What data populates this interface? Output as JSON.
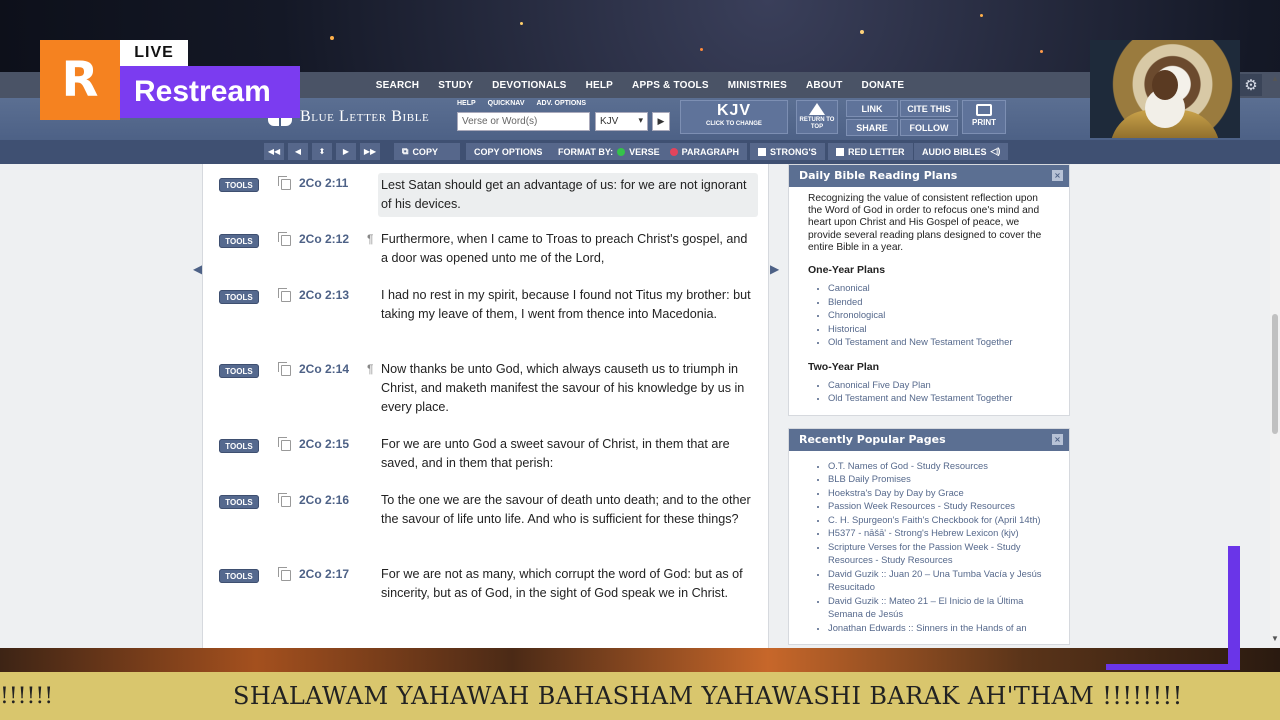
{
  "overlay": {
    "logo_letter": "R",
    "live_label": "LIVE",
    "brand": "Restream",
    "ticker_left": "!!!!!!",
    "ticker_text": "SHALAWAM YAHAWAH BAHASHAM YAHAWASHI BARAK AH'THAM !!!!!!!!"
  },
  "colors": {
    "restream_orange": "#f58220",
    "restream_purple": "#7b3cf0",
    "blb_blue": "#4d6186",
    "ticker_gold": "#d9c66d"
  },
  "topnav": [
    "SEARCH",
    "STUDY",
    "DEVOTIONALS",
    "HELP",
    "APPS & TOOLS",
    "MINISTRIES",
    "ABOUT",
    "DONATE"
  ],
  "toolbar": {
    "logo_text": "Blue Letter Bible",
    "labels": [
      "HELP",
      "QUICKNAV",
      "ADV. OPTIONS"
    ],
    "search_placeholder": "Verse or Word(s)",
    "version_value": "KJV",
    "go_symbol": "▶",
    "kjv_label": "KJV",
    "kjv_sub": "CLICK TO CHANGE",
    "return_top": "RETURN TO TOP",
    "link": "LINK",
    "cite_this": "CITE THIS",
    "share": "SHARE",
    "follow": "FOLLOW",
    "print": "PRINT"
  },
  "subbar": {
    "arrows": [
      "◀◀",
      "◀",
      "⬍",
      "▶",
      "▶▶"
    ],
    "copy": "COPY",
    "copy_options": "COPY OPTIONS",
    "format_by": "FORMAT BY:",
    "verse": "VERSE",
    "paragraph": "PARAGRAPH",
    "strongs": "STRONG'S",
    "red_letter": "RED LETTER",
    "audio_bibles": "AUDIO BIBLES"
  },
  "verses": [
    {
      "tools": "TOOLS",
      "ref": "2Co 2:11",
      "pilcrow": "",
      "text": "Lest Satan should get an advantage of us: for we are not ignorant of his devices.",
      "highlighted": true
    },
    {
      "tools": "TOOLS",
      "ref": "2Co 2:12",
      "pilcrow": "¶",
      "text": "Furthermore, when I came to Troas to preach Christ's gospel, and a door was opened unto me of the Lord,"
    },
    {
      "tools": "TOOLS",
      "ref": "2Co 2:13",
      "pilcrow": "",
      "text": "I had no rest in my spirit, because I found not Titus my brother: but taking my leave of them, I went from thence into Macedonia."
    },
    {
      "tools": "TOOLS",
      "ref": "2Co 2:14",
      "pilcrow": "¶",
      "text": "Now thanks be unto God, which always causeth us to triumph in Christ, and maketh manifest the savour of his knowledge by us in every place."
    },
    {
      "tools": "TOOLS",
      "ref": "2Co 2:15",
      "pilcrow": "",
      "text": "For we are unto God a sweet savour of Christ, in them that are saved, and in them that perish:"
    },
    {
      "tools": "TOOLS",
      "ref": "2Co 2:16",
      "pilcrow": "",
      "text": "To the one we are the savour of death unto death; and to the other the savour of life unto life. And who is sufficient for these things?"
    },
    {
      "tools": "TOOLS",
      "ref": "2Co 2:17",
      "pilcrow": "",
      "text": "For we are not as many, which corrupt the word of God: but as of sincerity, but as of God, in the sight of God speak we in Christ."
    }
  ],
  "reading_plans": {
    "title": "Daily Bible Reading Plans",
    "intro": "Recognizing the value of consistent reflection upon the Word of God in order to refocus one's mind and heart upon Christ and His Gospel of peace, we provide several reading plans designed to cover the entire Bible in a year.",
    "one_year_title": "One-Year Plans",
    "one_year": [
      "Canonical",
      "Blended",
      "Chronological",
      "Historical",
      "Old Testament and New Testament Together"
    ],
    "two_year_title": "Two-Year Plan",
    "two_year": [
      "Canonical Five Day Plan",
      "Old Testament and New Testament Together"
    ]
  },
  "popular": {
    "title": "Recently Popular Pages",
    "items": [
      "O.T. Names of God - Study Resources",
      "BLB Daily Promises",
      "Hoekstra's Day by Day by Grace",
      "Passion Week Resources - Study Resources",
      "C. H. Spurgeon's Faith's Checkbook for (April 14th)",
      "H5377 - nāšā' - Strong's Hebrew Lexicon (kjv)",
      "Scripture Verses for the Passion Week - Study Resources - Study Resources",
      "David Guzik :: Juan 20 – Una Tumba Vacía y Jesús Resucitado",
      "David Guzik :: Mateo 21 – El Inicio de la Última Semana de Jesús",
      "Jonathan Edwards :: Sinners in the Hands of an"
    ]
  },
  "icons": {
    "close": "×",
    "gear": "⚙",
    "scroll_up": "▲",
    "scroll_down": "▼",
    "arrow_left": "◀",
    "arrow_right": "▶"
  }
}
